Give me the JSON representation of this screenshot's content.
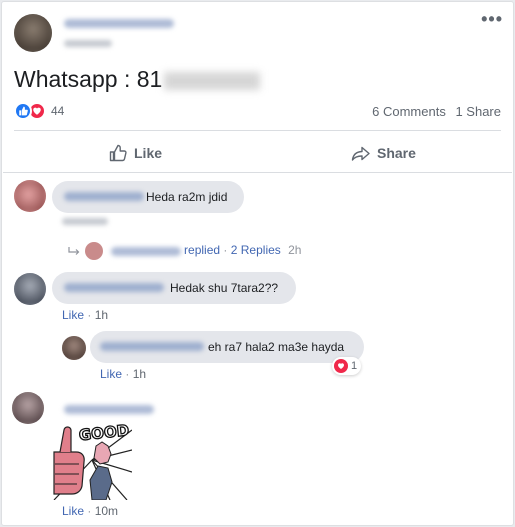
{
  "post": {
    "text_visible": "Whatsapp : 81",
    "reaction_count": "44",
    "comments_label": "6 Comments",
    "shares_label": "1 Share",
    "reaction_icons": [
      "like-icon",
      "love-icon"
    ]
  },
  "actions": {
    "like_label": "Like",
    "share_label": "Share"
  },
  "comments": [
    {
      "text": "Heda ra2m jdid",
      "replies_summary": {
        "replied_label": "replied",
        "sep": "·",
        "count_label": "2 Replies",
        "time": "2h"
      }
    },
    {
      "text": "Hedak shu 7tara2??",
      "like_label": "Like",
      "sep": "·",
      "time": "1h"
    },
    {
      "text": "eh ra7 hala2 ma3e hayda",
      "like_label": "Like",
      "sep": "·",
      "time": "1h",
      "love_count": "1"
    },
    {
      "sticker_text": "GOOD",
      "like_label": "Like",
      "sep": "·",
      "time": "10m"
    }
  ],
  "colors": {
    "link": "#4267b2",
    "like_blue": "#2078f4",
    "love_red": "#f0284a",
    "bubble_bg": "#e4e6eb",
    "muted": "#606770"
  }
}
